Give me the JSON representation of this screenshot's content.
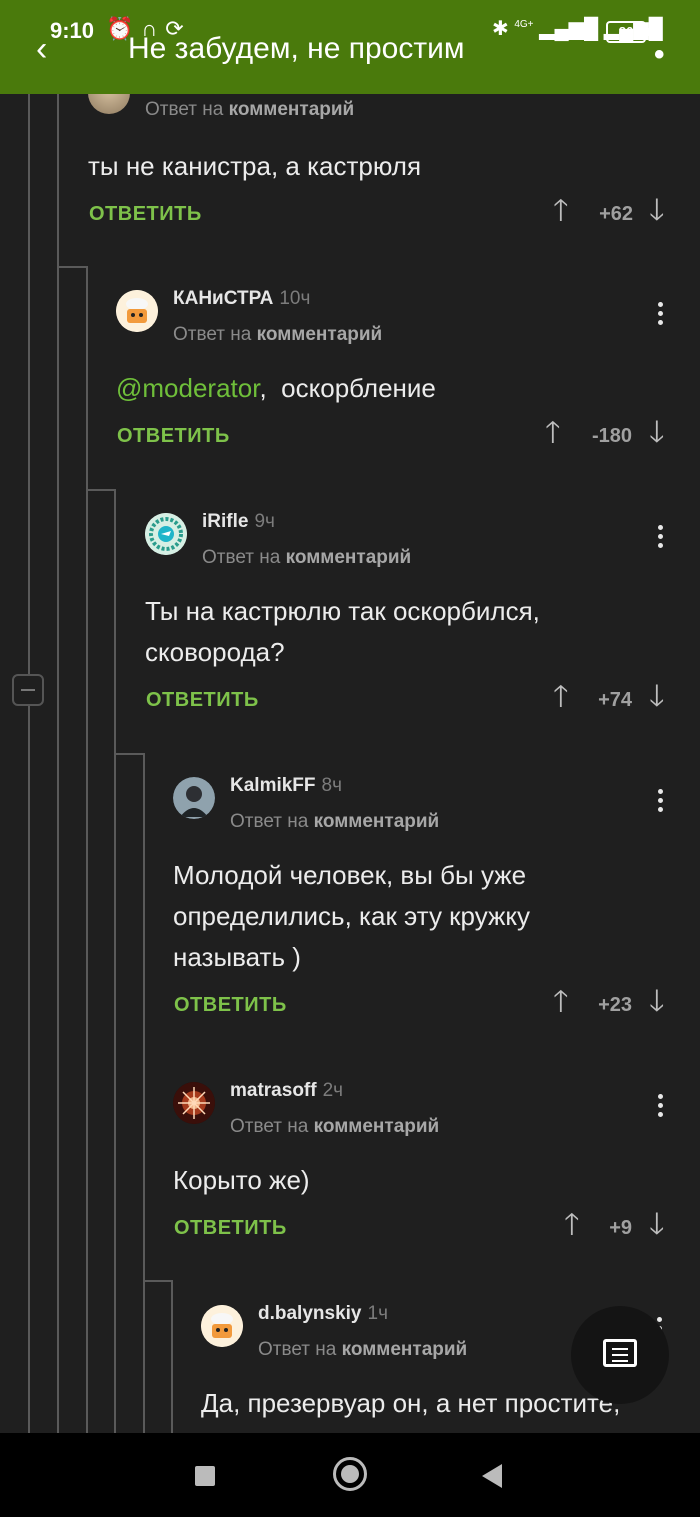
{
  "status_bar": {
    "time": "9:10",
    "battery": "86",
    "network": "4G+"
  },
  "app_bar": {
    "title": "Не забудем, не простим"
  },
  "comments": [
    {
      "author": "",
      "age": "",
      "reply_prefix": "Ответ на",
      "reply_target": "комментарий",
      "text": "ты не канистра, а кастрюля",
      "reply_label": "ОТВЕТИТЬ",
      "rating": "+62"
    },
    {
      "author": "КАНиСТРА",
      "age": "10ч",
      "reply_prefix": "Ответ на",
      "reply_target": "комментарий",
      "mention": "@moderator",
      "text_after_mention": ",  оскорбление",
      "reply_label": "ОТВЕТИТЬ",
      "rating": "-180"
    },
    {
      "author": "iRifle",
      "age": "9ч",
      "reply_prefix": "Ответ на",
      "reply_target": "комментарий",
      "text_line1": "Ты на кастрюлю так оскорбился,",
      "text_line2": "сковорода?",
      "reply_label": "ОТВЕТИТЬ",
      "rating": "+74"
    },
    {
      "author": "KalmikFF",
      "age": "8ч",
      "reply_prefix": "Ответ на",
      "reply_target": "комментарий",
      "text_line1": "Молодой человек, вы бы уже",
      "text_line2": "определились, как эту кружку",
      "text_line3": "называть )",
      "reply_label": "ОТВЕТИТЬ",
      "rating": "+23"
    },
    {
      "author": "matrasoff",
      "age": "2ч",
      "reply_prefix": "Ответ на",
      "reply_target": "комментарий",
      "text": "Корыто же)",
      "reply_label": "ОТВЕТИТЬ",
      "rating": "+9"
    },
    {
      "author": "d.balynskiy",
      "age": "1ч",
      "reply_prefix": "Ответ на",
      "reply_target": "комментарий",
      "text": "Да, презервуар он, а нет простите,"
    }
  ],
  "colors": {
    "accent": "#7ec24a",
    "app_bar": "#4a7a0c",
    "background": "#1f1f1f"
  }
}
